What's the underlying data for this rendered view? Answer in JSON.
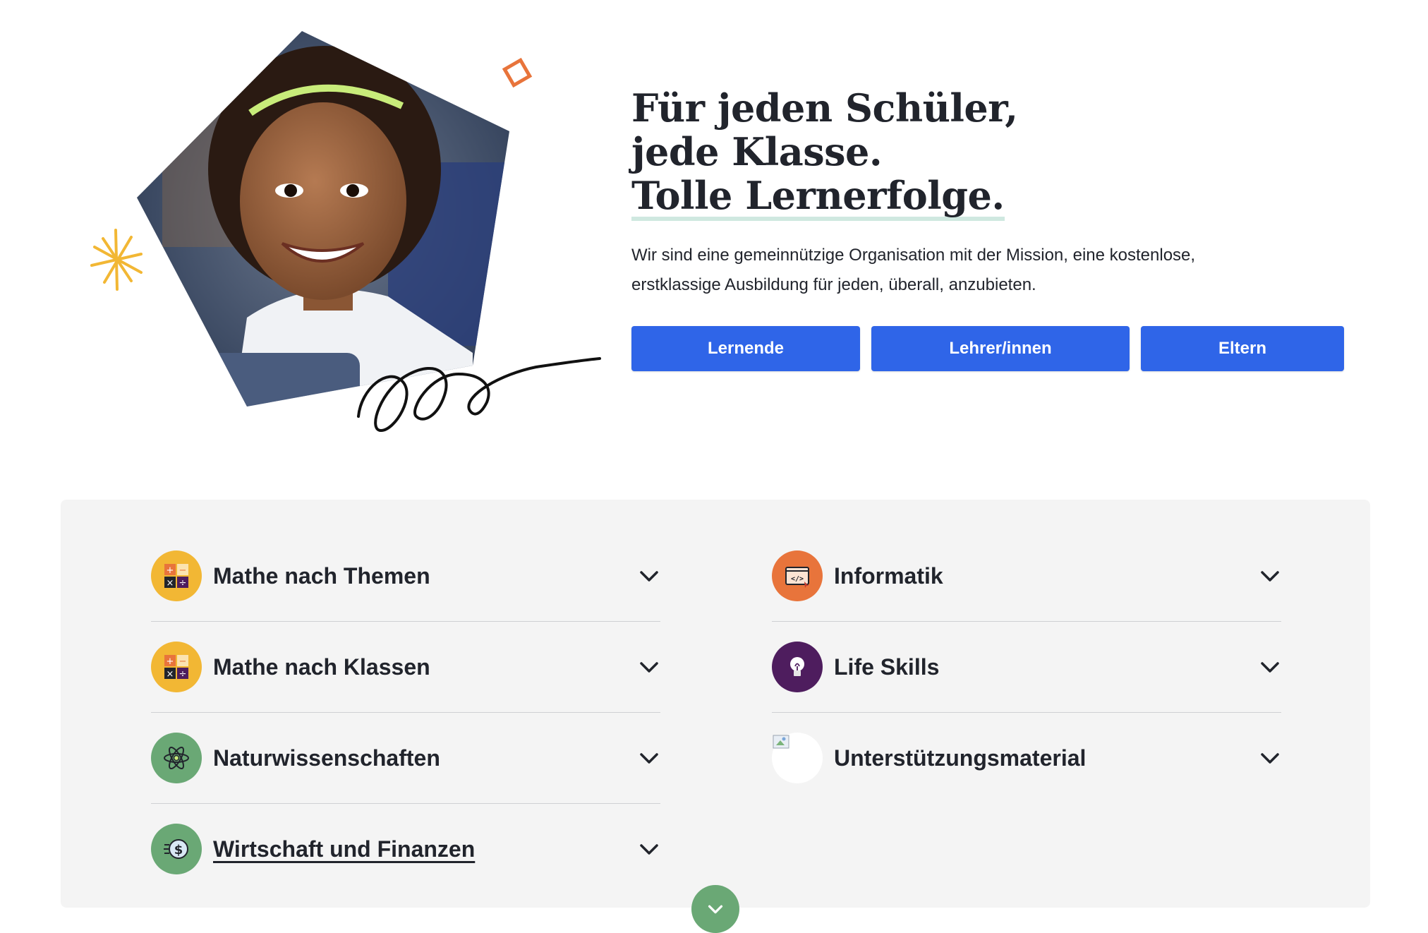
{
  "hero": {
    "headline_line1": "Für jeden Schüler,",
    "headline_line2": "jede Klasse.",
    "headline_line3": "Tolle Lernerfolge.",
    "subtitle": "Wir sind eine gemeinnützige Organisation mit der Mission, eine kostenlose, erstklassige Ausbildung für jeden, überall, anzubieten.",
    "buttons": [
      "Lernende",
      "Lehrer/innen",
      "Eltern"
    ]
  },
  "subjects": {
    "left": [
      {
        "label": "Mathe nach Themen",
        "icon": "math-operators-icon"
      },
      {
        "label": "Mathe nach Klassen",
        "icon": "math-operators-icon"
      },
      {
        "label": "Naturwissenschaften",
        "icon": "atom-icon"
      },
      {
        "label": "Wirtschaft und Finanzen",
        "icon": "coin-dollar-icon"
      }
    ],
    "right": [
      {
        "label": "Informatik",
        "icon": "code-window-icon"
      },
      {
        "label": "Life Skills",
        "icon": "lightbulb-icon"
      },
      {
        "label": "Unterstützungsmaterial",
        "icon": "broken-image-icon"
      }
    ]
  },
  "colors": {
    "primary_button": "#2f65e8",
    "panel_background": "#f4f4f4",
    "math_icon_bg": "#f2b734",
    "science_icon_bg": "#6aa875",
    "computing_icon_bg": "#e8743b",
    "life_skills_icon_bg": "#4e1d5e",
    "expand_button": "#6aa875"
  }
}
